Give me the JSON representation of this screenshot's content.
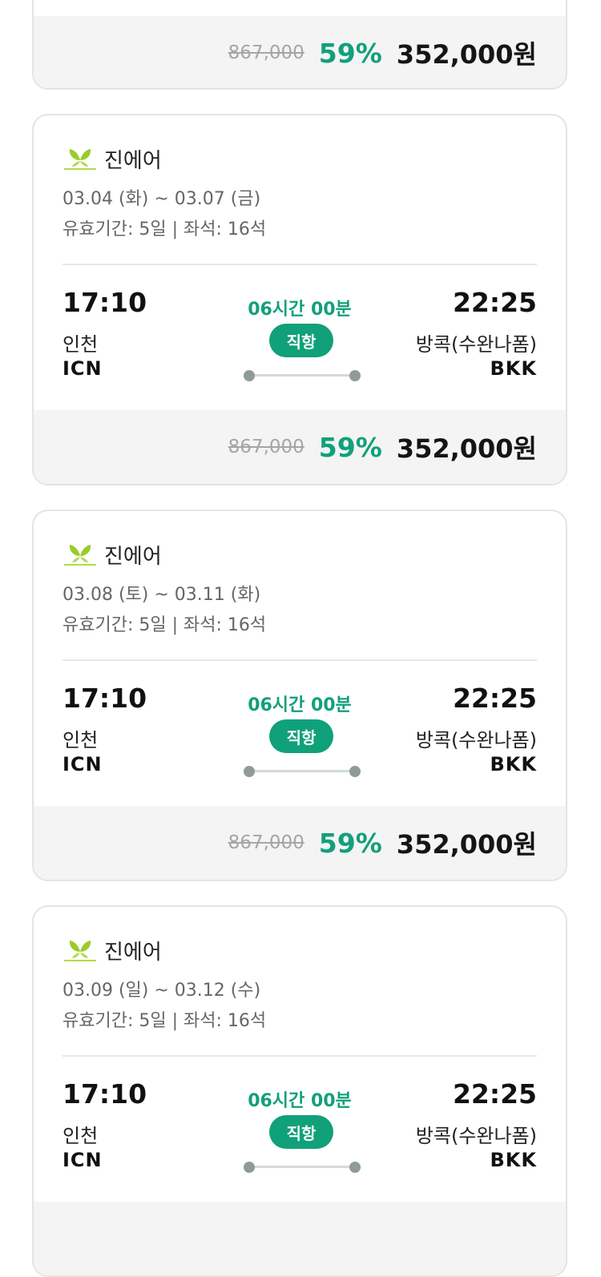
{
  "theme": {
    "accent": "#12a07a",
    "badge": "#10a07a",
    "price_bg": "#f4f4f4",
    "logo_green": "#9bcb2b"
  },
  "cards": [
    {
      "original_price": "867,000",
      "discount": "59%",
      "final_price": "352,000원"
    },
    {
      "airline": "진에어",
      "logo_icon": "jinair-logo-icon",
      "dates": "03.04 (화) ~ 03.07 (금)",
      "meta": "유효기간: 5일 | 좌석: 16석",
      "departure": {
        "time": "17:10",
        "city": "인천",
        "code": "ICN"
      },
      "arrival": {
        "time": "22:25",
        "city": "방콕(수완나폼)",
        "code": "BKK"
      },
      "duration": "06시간 00분",
      "type": "직항",
      "original_price": "867,000",
      "discount": "59%",
      "final_price": "352,000원"
    },
    {
      "airline": "진에어",
      "logo_icon": "jinair-logo-icon",
      "dates": "03.08 (토) ~ 03.11 (화)",
      "meta": "유효기간: 5일 | 좌석: 16석",
      "departure": {
        "time": "17:10",
        "city": "인천",
        "code": "ICN"
      },
      "arrival": {
        "time": "22:25",
        "city": "방콕(수완나폼)",
        "code": "BKK"
      },
      "duration": "06시간 00분",
      "type": "직항",
      "original_price": "867,000",
      "discount": "59%",
      "final_price": "352,000원"
    },
    {
      "airline": "진에어",
      "logo_icon": "jinair-logo-icon",
      "dates": "03.09 (일) ~ 03.12 (수)",
      "meta": "유효기간: 5일 | 좌석: 16석",
      "departure": {
        "time": "17:10",
        "city": "인천",
        "code": "ICN"
      },
      "arrival": {
        "time": "22:25",
        "city": "방콕(수완나폼)",
        "code": "BKK"
      },
      "duration": "06시간 00분",
      "type": "직항"
    }
  ]
}
